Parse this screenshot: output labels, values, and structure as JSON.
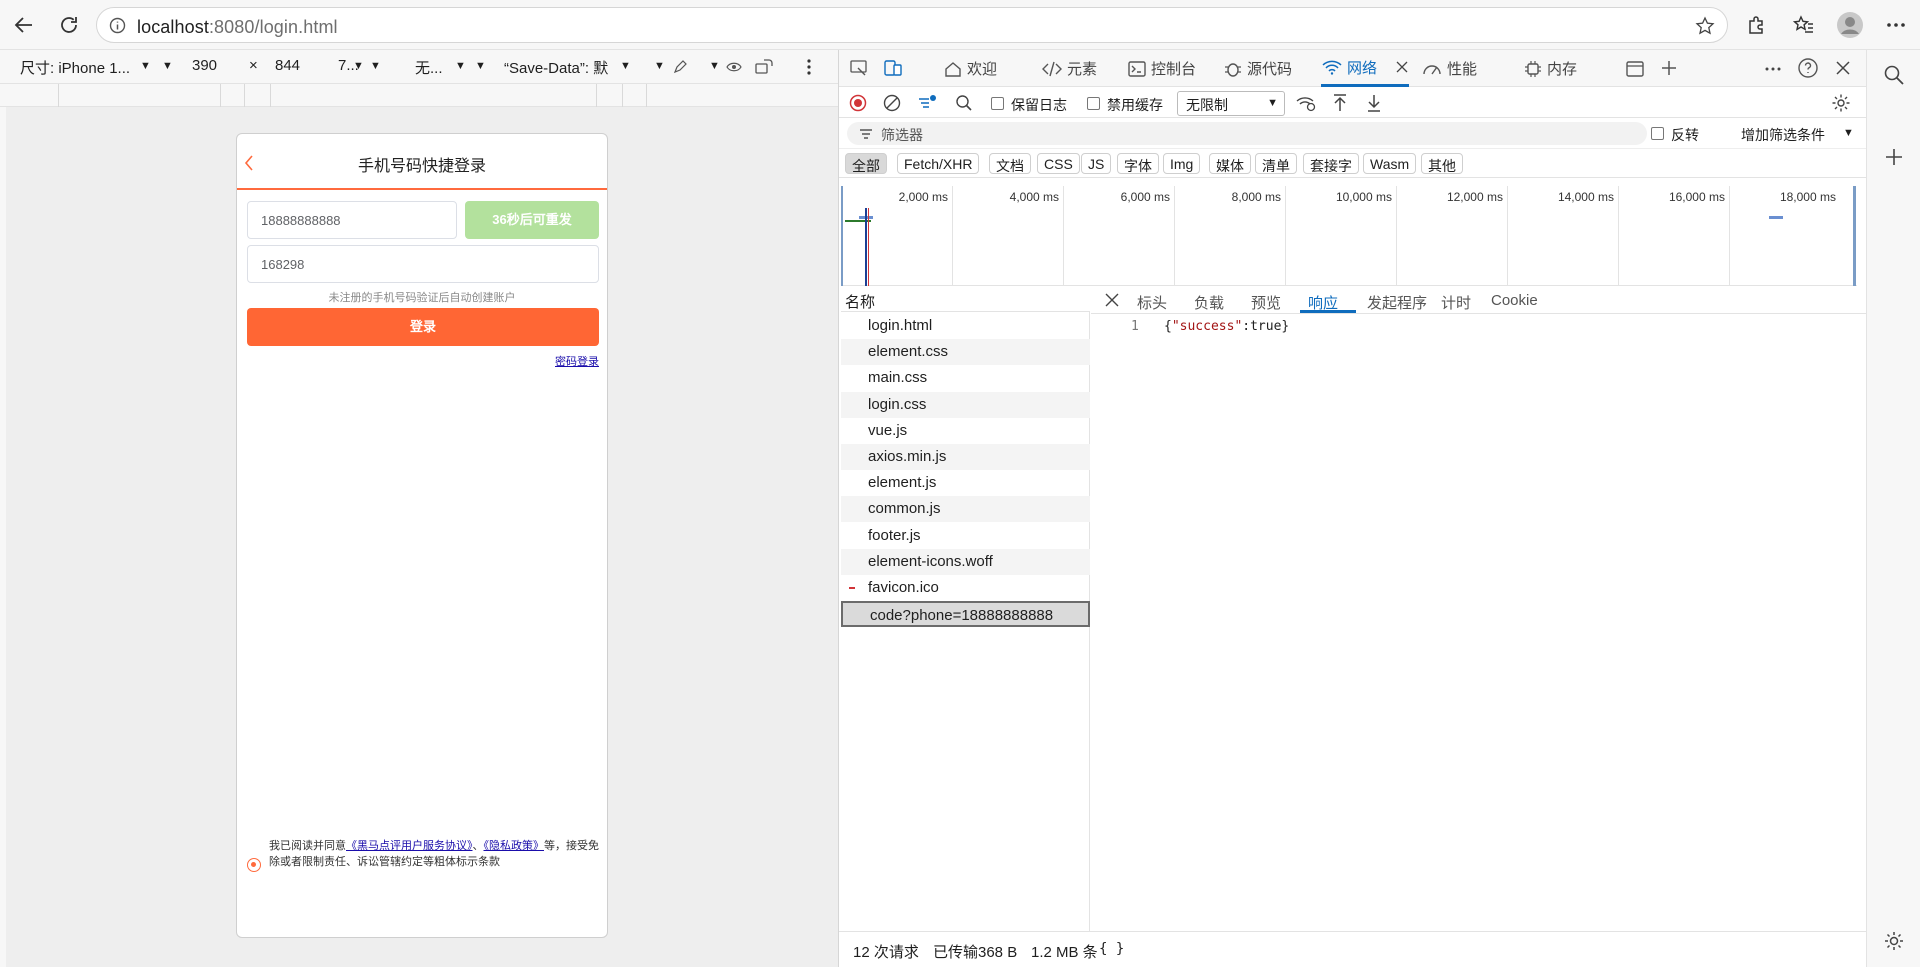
{
  "browser": {
    "url_host": "localhost",
    "url_rest": ":8080/login.html"
  },
  "emulation": {
    "device": "尺寸: iPhone 1...",
    "width": "390",
    "times": "×",
    "height": "844",
    "zoom": "7...",
    "throttle": "无...",
    "save_data": "“Save-Data”: 默"
  },
  "phone": {
    "title": "手机号码快捷登录",
    "phone_value": "18888888888",
    "send_code_label": "36秒后可重发",
    "code_value": "168298",
    "hint": "未注册的手机号码验证后自动创建账户",
    "login_label": "登录",
    "password_login": "密码登录",
    "agree_prefix": "我已阅读并同意",
    "agree_link1": "《黑马点评用户服务协议》",
    "agree_sep": "、",
    "agree_link2": "《隐私政策》",
    "agree_suffix": "等，接受免除或者限制责任、诉讼管辖约定等粗体标示条款"
  },
  "devtools": {
    "tabs": [
      "欢迎",
      "元素",
      "控制台",
      "源代码",
      "网络",
      "性能",
      "内存"
    ],
    "preserve_log": "保留日志",
    "disable_cache": "禁用缓存",
    "throttle": "无限制",
    "filter_placeholder": "筛选器",
    "invert": "反转",
    "more_filters": "增加筛选条件",
    "types": [
      "全部",
      "Fetch/XHR",
      "文档",
      "CSS",
      "JS",
      "字体",
      "Img",
      "媒体",
      "清单",
      "套接字",
      "Wasm",
      "其他"
    ],
    "timeline_ticks": [
      "2,000 ms",
      "4,000 ms",
      "6,000 ms",
      "8,000 ms",
      "10,000 ms",
      "12,000 ms",
      "14,000 ms",
      "16,000 ms",
      "18,000 ms"
    ],
    "name_header": "名称",
    "requests": [
      "login.html",
      "element.css",
      "main.css",
      "login.css",
      "vue.js",
      "axios.min.js",
      "element.js",
      "common.js",
      "footer.js",
      "element-icons.woff",
      "favicon.ico",
      "code?phone=18888888888"
    ],
    "detail_tabs": [
      "标头",
      "负载",
      "预览",
      "响应",
      "发起程序",
      "计时",
      "Cookie"
    ],
    "response_line_no": "1",
    "response_open": "{",
    "response_key": "\"success\"",
    "response_colon": ":",
    "response_value": "true",
    "response_close": "}",
    "status_requests": "12 次请求",
    "status_transferred": "已传输368 B",
    "status_size": "1.2 MB 条",
    "status_braces": "{ }"
  },
  "colors": {
    "accent": "#0f6cbd",
    "brand_orange": "#ff6634",
    "send_green": "#b3e19d"
  }
}
